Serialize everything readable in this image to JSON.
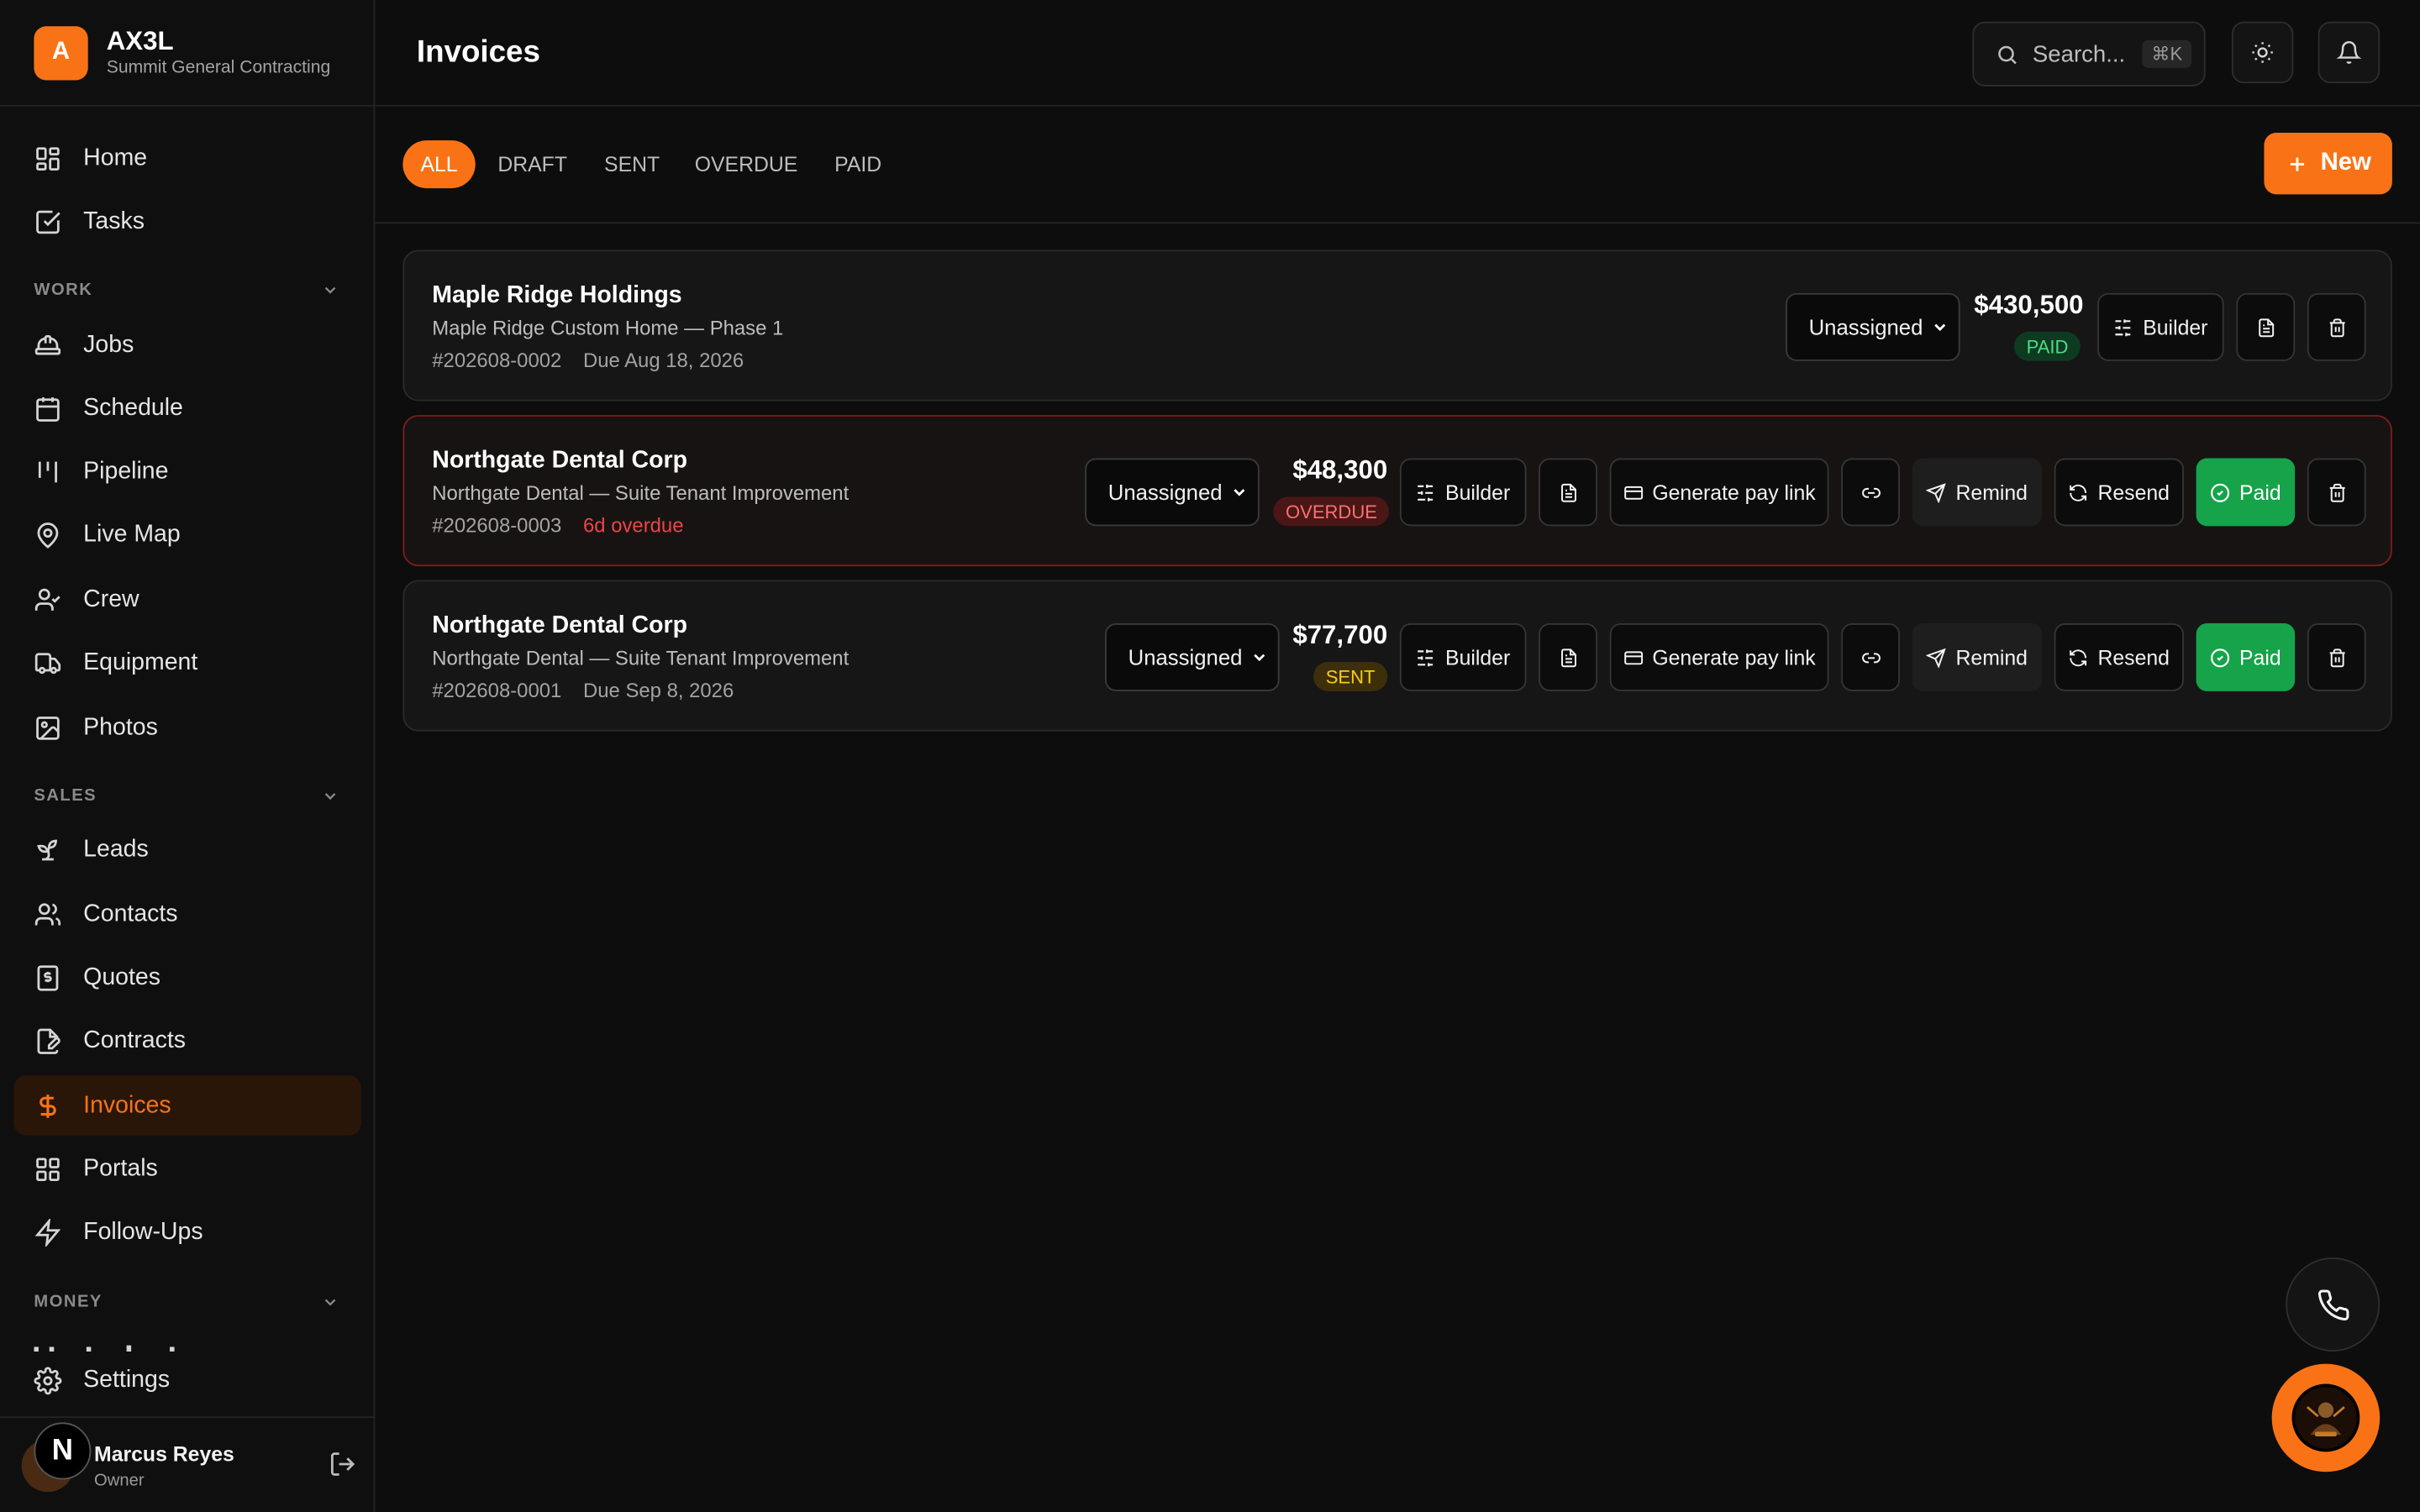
{
  "brand": {
    "logo_letter": "A",
    "name": "AX3L",
    "company": "Summit General Contracting"
  },
  "nav": {
    "home": "Home",
    "tasks": "Tasks",
    "work_label": "WORK",
    "jobs": "Jobs",
    "schedule": "Schedule",
    "pipeline": "Pipeline",
    "live_map": "Live Map",
    "crew": "Crew",
    "equipment": "Equipment",
    "photos": "Photos",
    "sales_label": "SALES",
    "leads": "Leads",
    "contacts": "Contacts",
    "quotes": "Quotes",
    "contracts": "Contracts",
    "invoices": "Invoices",
    "portals": "Portals",
    "follow_ups": "Follow-Ups",
    "money_label": "MONEY",
    "settings": "Settings"
  },
  "user": {
    "badge": "N",
    "name": "Marcus Reyes",
    "role": "Owner"
  },
  "header": {
    "title": "Invoices",
    "search_placeholder": "Search...",
    "search_shortcut": "⌘K"
  },
  "tabs": [
    "ALL",
    "DRAFT",
    "SENT",
    "OVERDUE",
    "PAID"
  ],
  "new_button": "New",
  "labels": {
    "assignee": "Unassigned",
    "builder": "Builder",
    "pay_link": "Generate pay link",
    "remind": "Remind",
    "resend": "Resend",
    "paid": "Paid"
  },
  "invoices": [
    {
      "client": "Maple Ridge Holdings",
      "project": "Maple Ridge Custom Home — Phase 1",
      "number": "#202608-0002",
      "due": "Due Aug 18, 2026",
      "amount": "$430,500",
      "status": "PAID"
    },
    {
      "client": "Northgate Dental Corp",
      "project": "Northgate Dental — Suite Tenant Improvement",
      "number": "#202608-0003",
      "due": "6d overdue",
      "amount": "$48,300",
      "status": "OVERDUE"
    },
    {
      "client": "Northgate Dental Corp",
      "project": "Northgate Dental — Suite Tenant Improvement",
      "number": "#202608-0001",
      "due": "Due Sep 8, 2026",
      "amount": "$77,700",
      "status": "SENT"
    }
  ],
  "colors": {
    "accent": "#f97316",
    "paid": "#16a34a",
    "overdue": "#ef4444",
    "sent": "#facc15"
  }
}
